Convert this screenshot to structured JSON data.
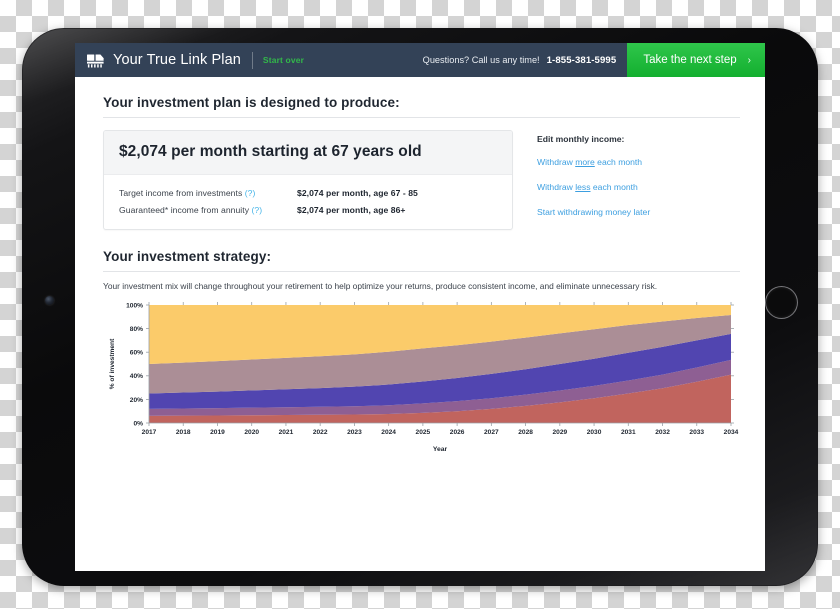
{
  "header": {
    "logo_icon": "chip-grid-logo-icon",
    "title": "Your True Link Plan",
    "start_over": "Start over",
    "questions": "Questions? Call us any time!",
    "phone": "1-855-381-5995",
    "cta_label": "Take the next step",
    "cta_chevron": "›",
    "bg_color": "#334257",
    "cta_color": "#1fbc3a",
    "start_over_color": "#32b84a"
  },
  "plan": {
    "section_title": "Your investment plan is designed to produce:",
    "headline": "$2,074 per month starting at 67 years old",
    "rows": [
      {
        "label": "Target income from investments",
        "help": "(?)",
        "value": "$2,074 per month, age 67 - 85"
      },
      {
        "label": "Guaranteed* income from annuity",
        "help": "(?)",
        "value": "$2,074 per month, age 86+"
      }
    ]
  },
  "edit_income": {
    "label": "Edit monthly income:",
    "links": [
      {
        "pre": "Withdraw ",
        "em": "more",
        "post": " each month"
      },
      {
        "pre": "Withdraw ",
        "em": "less",
        "post": " each month"
      },
      {
        "pre": "Start withdrawing money later",
        "em": "",
        "post": ""
      }
    ],
    "link_color": "#3d9fe0"
  },
  "strategy": {
    "section_title": "Your investment strategy:",
    "note": "Your investment mix will change throughout your retirement to help optimize your returns, produce consistent income, and eliminate unnecessary risk."
  },
  "chart_data": {
    "type": "area",
    "title": "",
    "xlabel": "Year",
    "ylabel": "% of investment",
    "categories": [
      2017,
      2018,
      2019,
      2020,
      2021,
      2022,
      2023,
      2024,
      2025,
      2026,
      2027,
      2028,
      2029,
      2030,
      2031,
      2032,
      2033,
      2034
    ],
    "tick_labels_x": [
      "2017",
      "2018",
      "2019",
      "2020",
      "2021",
      "2022",
      "2023",
      "2024",
      "2025",
      "2026",
      "2027",
      "2028",
      "2029",
      "2030",
      "2031",
      "2032",
      "2033",
      "2034"
    ],
    "tick_labels_y": [
      "0%",
      "20%",
      "40%",
      "60%",
      "80%",
      "100%"
    ],
    "ylim": [
      0,
      100
    ],
    "yticks": [
      0,
      20,
      40,
      60,
      80,
      100
    ],
    "grid": false,
    "legend": "none",
    "stacked": true,
    "series": [
      {
        "name": "band-1-red",
        "color": "#c1645e",
        "values": [
          6,
          6.2,
          6.4,
          6.6,
          6.8,
          7.0,
          7.2,
          7.6,
          8.6,
          10.0,
          12.0,
          14.5,
          17.5,
          21.0,
          25.0,
          29.5,
          35.0,
          41.0
        ]
      },
      {
        "name": "band-2-mauve",
        "color": "#8e5f93",
        "values": [
          6,
          6.1,
          6.2,
          6.4,
          6.6,
          6.8,
          7.0,
          7.4,
          8.0,
          8.5,
          9.0,
          9.5,
          10.0,
          10.5,
          11.0,
          11.5,
          12.0,
          12.5
        ]
      },
      {
        "name": "band-3-indigo",
        "color": "#5145b0",
        "values": [
          13,
          13.5,
          14.0,
          14.6,
          15.2,
          15.8,
          16.6,
          17.6,
          18.6,
          19.6,
          20.6,
          21.6,
          22.5,
          23.0,
          23.5,
          23.5,
          23.0,
          22.0
        ]
      },
      {
        "name": "band-4-dusty-rose",
        "color": "#ab8e96",
        "values": [
          25,
          25.4,
          25.8,
          26.2,
          26.6,
          27.0,
          27.4,
          27.8,
          28.0,
          27.8,
          27.4,
          26.8,
          26.0,
          25.0,
          23.5,
          21.5,
          19.0,
          16.0
        ]
      },
      {
        "name": "band-5-amber",
        "color": "#fbcb6a",
        "values": [
          50,
          48.8,
          47.6,
          46.2,
          44.8,
          43.4,
          41.8,
          39.6,
          36.8,
          34.1,
          31.0,
          27.6,
          24.0,
          20.5,
          17.0,
          14.0,
          11.0,
          8.5
        ]
      }
    ]
  }
}
